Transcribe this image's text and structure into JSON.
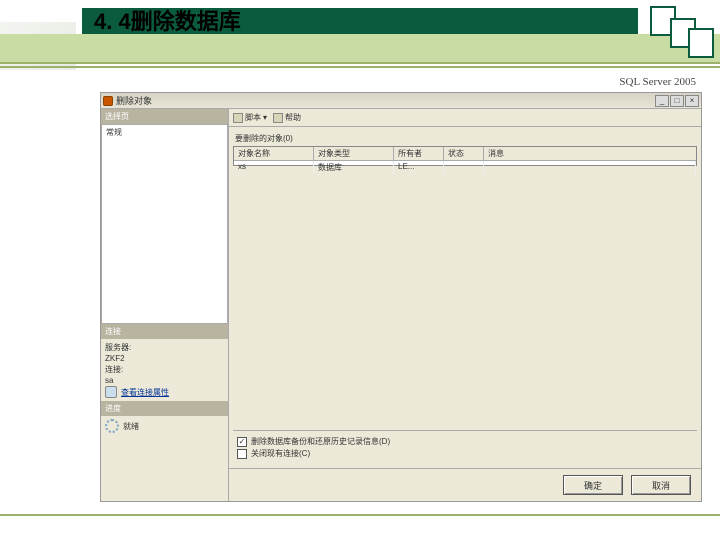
{
  "slide": {
    "title": "4. 4删除数据库",
    "subtitle": "SQL Server 2005"
  },
  "dialog": {
    "title": "删除对象",
    "minimize": "_",
    "maximize": "□",
    "close": "×",
    "left": {
      "section_select": "选择页",
      "tree_general": "常规",
      "section_conn": "连接",
      "server_label": "服务器:",
      "server_value": "ZKF2",
      "conn_label": "连接:",
      "conn_value": "sa",
      "view_props_link": "查看连接属性",
      "section_progress": "进度",
      "progress_text": "就绪"
    },
    "toolbar": {
      "script": "脚本",
      "help": "帮助"
    },
    "content": {
      "label": "要删除的对象(0)",
      "cols": {
        "c1": "对象名称",
        "c2": "对象类型",
        "c3": "所有者",
        "c4": "状态",
        "c5": "消息"
      },
      "row": {
        "c1": "xs",
        "c2": "数据库",
        "c3": "LE...",
        "c4": "",
        "c5": ""
      },
      "chk1_checked": "✓",
      "chk1": "删除数据库备份和还原历史记录信息(D)",
      "chk2": "关闭现有连接(C)"
    },
    "buttons": {
      "ok": "确定",
      "cancel": "取消"
    }
  }
}
